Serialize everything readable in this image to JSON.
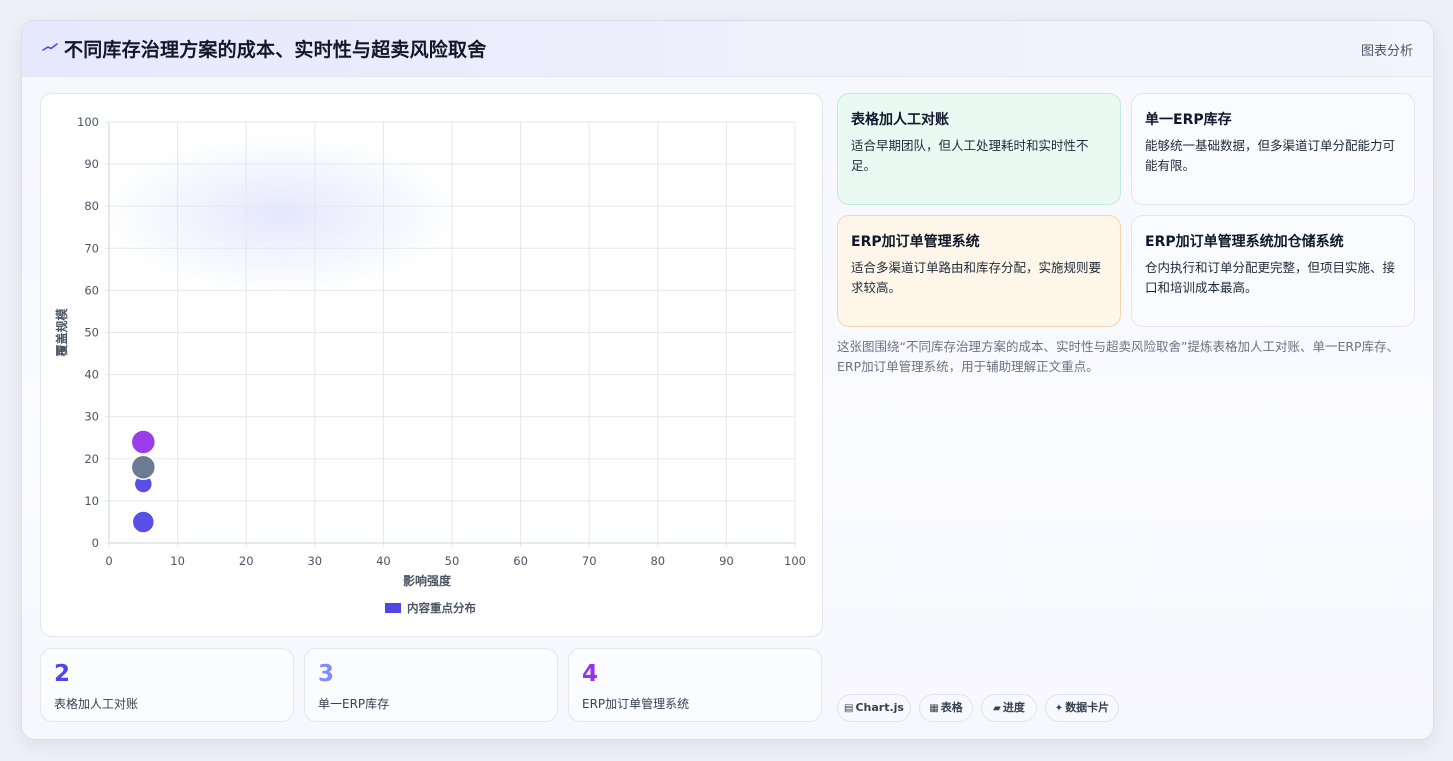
{
  "header": {
    "title": "不同库存治理方案的成本、实时性与超卖风险取舍",
    "tag": "图表分析"
  },
  "chart_data": {
    "type": "scatter",
    "xlabel": "影响强度",
    "ylabel": "覆盖规模",
    "xlim": [
      0,
      100
    ],
    "ylim": [
      0,
      100
    ],
    "xticks": [
      0,
      10,
      20,
      30,
      40,
      50,
      60,
      70,
      80,
      90,
      100
    ],
    "yticks": [
      0,
      10,
      20,
      30,
      40,
      50,
      60,
      70,
      80,
      90,
      100
    ],
    "grid": true,
    "legend": "bottom",
    "series": [
      {
        "name": "内容重点分布",
        "color": "#4f46e5",
        "points": [
          {
            "x": 5,
            "y": 5,
            "r": 11,
            "color": "#4f46e5"
          },
          {
            "x": 5,
            "y": 14,
            "r": 9,
            "color": "#4f46e5"
          },
          {
            "x": 5,
            "y": 18,
            "r": 12,
            "color": "#64748b"
          },
          {
            "x": 5,
            "y": 24,
            "r": 12,
            "color": "#9333ea"
          }
        ]
      }
    ]
  },
  "stats": [
    {
      "value": "2",
      "label": "表格加人工对账",
      "color": "#4f46e5"
    },
    {
      "value": "3",
      "label": "单一ERP库存",
      "color": "#818cf8"
    },
    {
      "value": "4",
      "label": "ERP加订单管理系统",
      "color": "#9333ea"
    }
  ],
  "cards": [
    {
      "title": "表格加人工对账",
      "text": "适合早期团队，但人工处理耗时和实时性不足。"
    },
    {
      "title": "单一ERP库存",
      "text": "能够统一基础数据，但多渠道订单分配能力可能有限。"
    },
    {
      "title": "ERP加订单管理系统",
      "text": "适合多渠道订单路由和库存分配，实施规则要求较高。"
    },
    {
      "title": "ERP加订单管理系统加仓储系统",
      "text": "仓内执行和订单分配更完整，但项目实施、接口和培训成本最高。"
    }
  ],
  "description": "这张图围绕“不同库存治理方案的成本、实时性与超卖风险取舍”提炼表格加人工对账、单一ERP库存、ERP加订单管理系统，用于辅助理解正文重点。",
  "chips": [
    {
      "icon": "▤",
      "label": "Chart.js"
    },
    {
      "icon": "▦",
      "label": "表格"
    },
    {
      "icon": "▰",
      "label": "进度"
    },
    {
      "icon": "✦",
      "label": "数据卡片"
    }
  ]
}
